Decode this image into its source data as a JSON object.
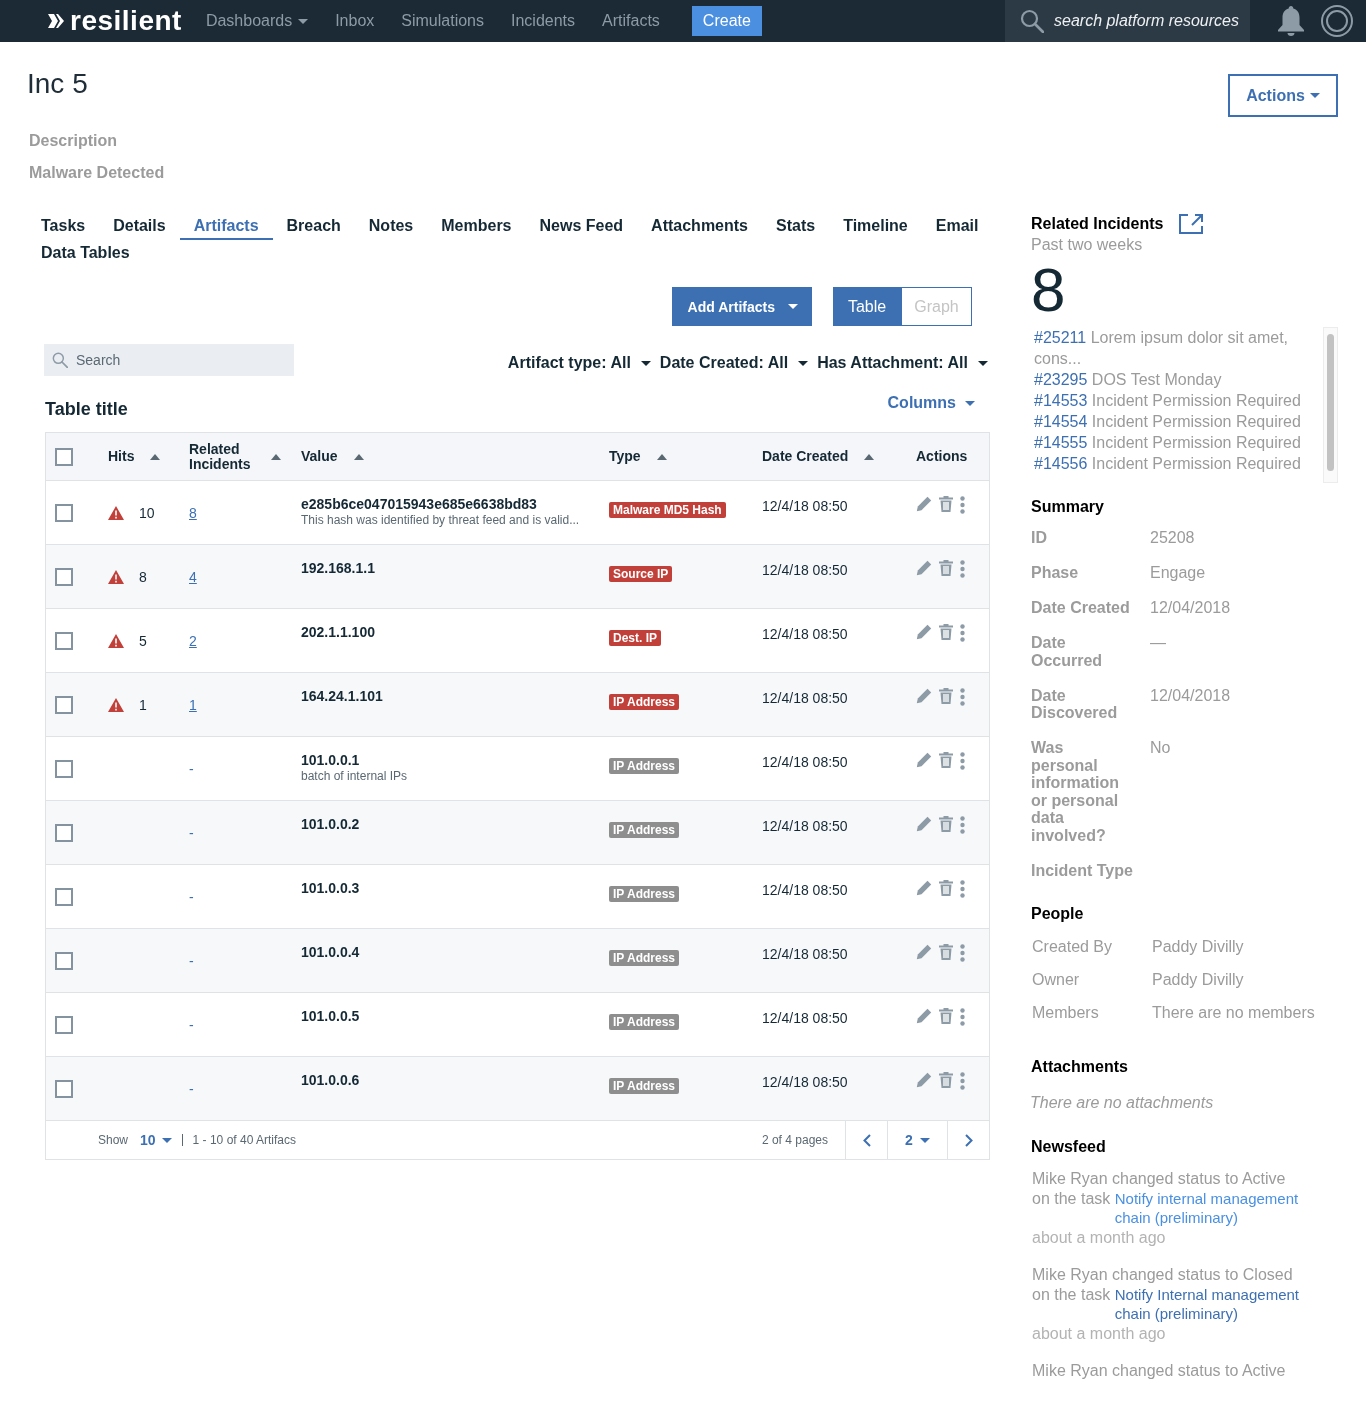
{
  "topbar": {
    "logo": "resilient",
    "nav": [
      {
        "label": "Dashboards",
        "dropdown": true
      },
      {
        "label": "Inbox",
        "dropdown": false
      },
      {
        "label": "Simulations",
        "dropdown": false
      },
      {
        "label": "Incidents",
        "dropdown": false
      },
      {
        "label": "Artifacts",
        "dropdown": false
      }
    ],
    "create_button": "Create",
    "search": {
      "placeholder": "search platform resources"
    }
  },
  "incident": {
    "title": "Inc 5",
    "actions_button": "Actions",
    "description_label": "Description",
    "description": "Malware Detected"
  },
  "tabs": [
    {
      "label": "Tasks",
      "selected": false
    },
    {
      "label": "Details",
      "selected": false
    },
    {
      "label": "Artifacts",
      "selected": true
    },
    {
      "label": "Breach",
      "selected": false
    },
    {
      "label": "Notes",
      "selected": false
    },
    {
      "label": "Members",
      "selected": false
    },
    {
      "label": "News Feed",
      "selected": false
    },
    {
      "label": "Attachments",
      "selected": false
    },
    {
      "label": "Stats",
      "selected": false
    },
    {
      "label": "Timeline",
      "selected": false
    },
    {
      "label": "Email",
      "selected": false
    },
    {
      "label": "Data Tables",
      "selected": false
    }
  ],
  "artifacts": {
    "add_button": "Add Artifacts",
    "view_toggle": [
      {
        "label": "Table",
        "selected": true
      },
      {
        "label": "Graph",
        "selected": false
      }
    ],
    "search": {
      "placeholder": "Search"
    },
    "filters": [
      "Artifact type: All",
      "Date Created: All",
      "Has Attachment: All"
    ],
    "table_title": "Table title",
    "columns_button": "Columns",
    "table": {
      "select_all": {
        "checked": false
      },
      "columns": [
        {
          "label": "Hits",
          "sortable": true
        },
        {
          "label": "Related Incidents",
          "sortable": true
        },
        {
          "label": "Value",
          "sortable": true
        },
        {
          "label": "Type",
          "sortable": true
        },
        {
          "label": "Date Created",
          "sortable": true
        },
        {
          "label": "Actions",
          "sortable": false
        }
      ],
      "rows": [
        {
          "checked": false,
          "hits": "10",
          "related": "8",
          "value": "e285b6ce047015943e685e6638bd83",
          "note": "This hash was identified by threat feed and is valid...",
          "type": {
            "label": "Malware MD5 Hash",
            "color": "#c2403a"
          },
          "date": "12/4/18 08:50"
        },
        {
          "checked": false,
          "hits": "8",
          "related": "4",
          "value": "192.168.1.1",
          "type": {
            "label": "Source IP",
            "color": "#c2403a"
          },
          "date": "12/4/18 08:50"
        },
        {
          "checked": false,
          "hits": "5",
          "related": "2",
          "value": "202.1.1.100",
          "type": {
            "label": "Dest. IP",
            "color": "#c2403a"
          },
          "date": "12/4/18 08:50"
        },
        {
          "checked": false,
          "hits": "1",
          "related": "1",
          "value": "164.24.1.101",
          "type": {
            "label": "IP Address",
            "color": "#c2403a"
          },
          "date": "12/4/18 08:50"
        },
        {
          "checked": false,
          "related": "-",
          "value": "101.0.0.1",
          "note": "batch of internal IPs",
          "type": {
            "label": "IP Address",
            "color": "#8e8e8e"
          },
          "date": "12/4/18 08:50"
        },
        {
          "checked": false,
          "related": "-",
          "value": "101.0.0.2",
          "type": {
            "label": "IP Address",
            "color": "#8e8e8e"
          },
          "date": "12/4/18 08:50"
        },
        {
          "checked": false,
          "related": "-",
          "value": "101.0.0.3",
          "type": {
            "label": "IP Address",
            "color": "#8e8e8e"
          },
          "date": "12/4/18 08:50"
        },
        {
          "checked": false,
          "related": "-",
          "value": "101.0.0.4",
          "type": {
            "label": "IP Address",
            "color": "#8e8e8e"
          },
          "date": "12/4/18 08:50"
        },
        {
          "checked": false,
          "related": "-",
          "value": "101.0.0.5",
          "type": {
            "label": "IP Address",
            "color": "#8e8e8e"
          },
          "date": "12/4/18 08:50"
        },
        {
          "checked": false,
          "related": "-",
          "value": "101.0.0.6",
          "type": {
            "label": "IP Address",
            "color": "#8e8e8e"
          },
          "date": "12/4/18 08:50"
        }
      ],
      "footer": {
        "show_label": "Show",
        "page_size": "10",
        "range": "1 - 10 of 40 Artifacs",
        "pages": "2 of 4 pages",
        "page": "2"
      }
    }
  },
  "sidebar": {
    "related": {
      "title": "Related Incidents",
      "subtitle": "Past two weeks",
      "count": "8",
      "incidents": [
        {
          "id": "#25211",
          "title": "Lorem ipsum dolor sit amet, cons..."
        },
        {
          "id": "#23295",
          "title": "DOS Test Monday"
        },
        {
          "id": "#14553",
          "title": "Incident Permission Required"
        },
        {
          "id": "#14554",
          "title": "Incident Permission Required"
        },
        {
          "id": "#14555",
          "title": "Incident Permission Required"
        },
        {
          "id": "#14556",
          "title": "Incident Permission Required"
        }
      ]
    },
    "summary": {
      "title": "Summary",
      "fields": [
        {
          "label": "ID",
          "value": "25208"
        },
        {
          "label": "Phase",
          "value": "Engage"
        },
        {
          "label": "Date Created",
          "value": "12/04/2018"
        },
        {
          "label": "Date Occurred",
          "value": "—"
        },
        {
          "label": "Date Discovered",
          "value": "12/04/2018"
        },
        {
          "label": "Was personal information or personal data involved?",
          "value": "No"
        },
        {
          "label": "Incident Type"
        }
      ]
    },
    "people": {
      "title": "People",
      "fields": [
        {
          "label": "Created By",
          "value": "Paddy Divilly"
        },
        {
          "label": "Owner",
          "value": "Paddy Divilly"
        },
        {
          "label": "Members",
          "value": "There are no members"
        }
      ]
    },
    "attachments": {
      "title": "Attachments",
      "empty": "There are no attachments"
    },
    "newsfeed": {
      "title": "Newsfeed",
      "items": [
        {
          "text": "Mike Ryan changed status to Active on the task",
          "link": "Notify internal management chain (preliminary)",
          "color": "#4a90e2",
          "time": "about a month ago"
        },
        {
          "text": "Mike Ryan changed status to Closed on the task",
          "link": "Notify Internal management chain (preliminary)",
          "color": "#3d70b2",
          "time": "about a month ago"
        },
        {
          "text": "Mike Ryan changed status to Active"
        }
      ]
    }
  }
}
